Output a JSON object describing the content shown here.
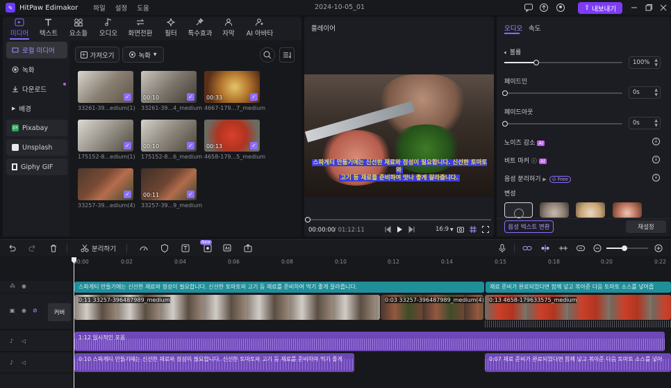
{
  "titlebar": {
    "app_name": "HitPaw Edimakor",
    "menus": [
      "파일",
      "설정",
      "도움"
    ],
    "project_title": "2024-10-05_01",
    "export_label": "내보내기"
  },
  "top_tabs": [
    {
      "label": "미디어",
      "icon": "media-icon"
    },
    {
      "label": "텍스트",
      "icon": "text-icon"
    },
    {
      "label": "요소들",
      "icon": "elements-icon"
    },
    {
      "label": "오디오",
      "icon": "audio-icon"
    },
    {
      "label": "화면전환",
      "icon": "transition-icon"
    },
    {
      "label": "필터",
      "icon": "filter-icon"
    },
    {
      "label": "특수효과",
      "icon": "effects-icon"
    },
    {
      "label": "자막",
      "icon": "subtitle-icon"
    },
    {
      "label": "AI 아바타",
      "icon": "avatar-icon"
    }
  ],
  "sidebar": {
    "items": [
      {
        "label": "로컬 미디어"
      },
      {
        "label": "녹화"
      },
      {
        "label": "다운로드"
      },
      {
        "label": "배경"
      },
      {
        "label": "Pixabay"
      },
      {
        "label": "Unsplash"
      },
      {
        "label": "Giphy GIF"
      }
    ]
  },
  "media": {
    "import_label": "가져오기",
    "record_label": "녹화",
    "items": [
      {
        "name": "33261-39...edium(1)",
        "duration": ""
      },
      {
        "name": "33261-39...4_medium",
        "duration": "00:10"
      },
      {
        "name": "4667-179...7_medium",
        "duration": "00:33"
      },
      {
        "name": "175152-8...edium(1)",
        "duration": ""
      },
      {
        "name": "175152-8...6_medium",
        "duration": "00:10"
      },
      {
        "name": "4658-179...5_medium",
        "duration": "00:13"
      },
      {
        "name": "33257-39...edium(4)",
        "duration": ""
      },
      {
        "name": "33257-39...9_medium",
        "duration": "00:11"
      }
    ]
  },
  "player": {
    "title": "플레이어",
    "subtitle_line1": "스파게티 만들기에는 신선한 재료와 정성이 필요합니다. 신선한 토마토와",
    "subtitle_line2": "고기 등 재료를 준비하여 맛나 좋게 잘라줍니다.",
    "current_time": "00:00:00",
    "total_time": "/ 01:12:11",
    "aspect_ratio": "16:9",
    "progress": 0
  },
  "properties": {
    "tabs": [
      "오디오",
      "속도"
    ],
    "volume_label": "볼륨",
    "volume_value": "100%",
    "volume_level": 0.27,
    "fadein_label": "페이드인",
    "fadein_value": "0s",
    "fadeout_label": "페이드아웃",
    "fadeout_value": "0s",
    "noise_label": "노이즈 감소",
    "beat_label": "비트 마커",
    "separate_label": "음성 분리하기",
    "ai_tag": "AI",
    "free_tag": "Free",
    "voice_label": "변성",
    "voice_text_button": "음성 텍스트 변환",
    "reset_button": "재설정"
  },
  "toolbar": {
    "split_label": "분리하기",
    "new_badge": "New"
  },
  "timeline": {
    "ticks": [
      "00:00",
      "0:02",
      "0:04",
      "0:06",
      "0:08",
      "0:10",
      "0:12",
      "0:14",
      "0:15",
      "0:18",
      "0:20",
      "0:22"
    ],
    "cover_label": "커버",
    "text_clip_1": "스파게티 만들기에는 신선한 재료와 정성이 필요합니다. 신선한 토마토와 고기 등 재료를 준비하여 먹기 좋게 잘라줍니다.",
    "text_clip_2": "재료 준비가 완료되었다면 함께 넣고 볶아준 다음 토마토 소스를 넣어줍",
    "video_clip_1": "0:11  33257-396487989_medium",
    "video_clip_2": "0:03  33257-396487989_medium(4)",
    "video_clip_3": "0:13  4658-179633575_medium",
    "audio_clip_1": "1:12  일시적인 포옹",
    "audio_clip_2": "0:10  스파게티 만들기에는 신선한 재료와 정성이 필요합니다. 신선한 토마토와 고기 등 재료를 준비하여 먹기 좋게",
    "audio_clip_3": "0:07  재료 준비가 완료되었다면 함께 넣고 볶아준 다음 토마토 소스를 넣어",
    "colors": {
      "text_track": "#1f8f9a",
      "audio_track": "#6f48b8",
      "accent": "#8b6dff"
    }
  }
}
